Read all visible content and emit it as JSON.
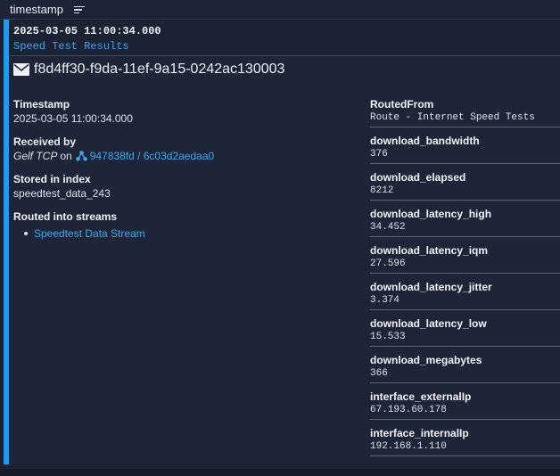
{
  "column_header": {
    "label": "timestamp",
    "sort_icon": "sort-lines-icon"
  },
  "row": {
    "timestamp": "2025-03-05 11:00:34.000",
    "message": "Speed Test Results"
  },
  "detail": {
    "message_id": "f8d4ff30-f9da-11ef-9a15-0242ac130003",
    "envelope_icon": "envelope-icon",
    "timestamp_label": "Timestamp",
    "timestamp_value": "2025-03-05 11:00:34.000",
    "received_by_label": "Received by",
    "received_input": "Gelf TCP",
    "received_on": "on",
    "received_node": "947838fd / 6c03d2aedaa0",
    "stored_label": "Stored in index",
    "stored_value": "speedtest_data_243",
    "routed_label": "Routed into streams",
    "streams": [
      "Speedtest Data Stream"
    ]
  },
  "fields": [
    {
      "key": "RoutedFrom",
      "value": "Route - Internet Speed Tests"
    },
    {
      "key": "download_bandwidth",
      "value": "376"
    },
    {
      "key": "download_elapsed",
      "value": "8212"
    },
    {
      "key": "download_latency_high",
      "value": "34.452"
    },
    {
      "key": "download_latency_iqm",
      "value": "27.596"
    },
    {
      "key": "download_latency_jitter",
      "value": "3.374"
    },
    {
      "key": "download_latency_low",
      "value": "15.533"
    },
    {
      "key": "download_megabytes",
      "value": "366"
    },
    {
      "key": "interface_externalIp",
      "value": "67.193.60.178"
    },
    {
      "key": "interface_internalIp",
      "value": "192.168.1.110"
    }
  ],
  "colors": {
    "accent": "#1d9bf0",
    "link": "#3ba8ee",
    "background": "#1b2234"
  }
}
